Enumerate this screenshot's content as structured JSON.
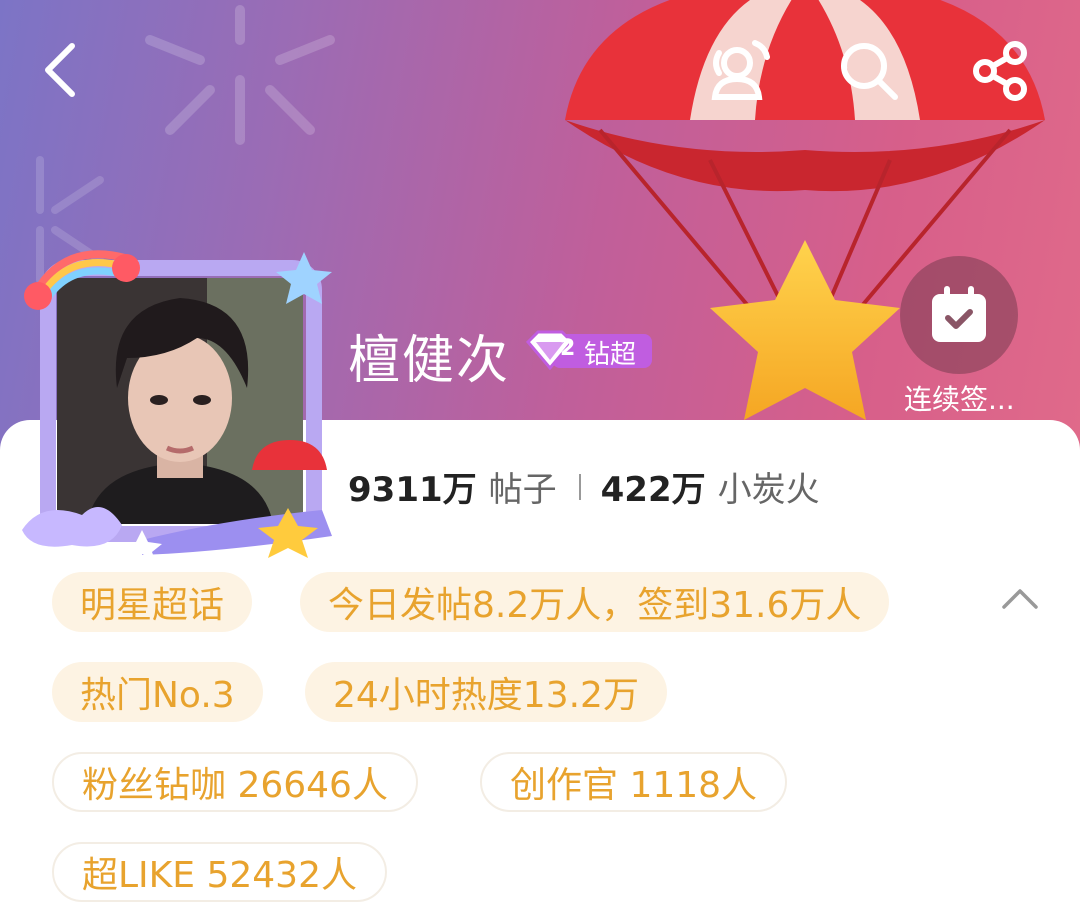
{
  "header": {
    "back_icon": "chevron-left-icon",
    "actions": [
      "friends-icon",
      "search-icon",
      "share-icon"
    ],
    "checkin_label": "连续签...",
    "colors": {
      "gradient_left": "#7c74c6",
      "gradient_right": "#e06a8a"
    }
  },
  "profile": {
    "name": "檀健次",
    "badge_level": "2",
    "badge_label": "钻超"
  },
  "stats": {
    "posts_value": "9311万",
    "posts_label": "帖子",
    "fire_value": "422万",
    "fire_label": "小炭火"
  },
  "tags": [
    {
      "label": "明星超话"
    },
    {
      "label": "今日发帖8.2万人，签到31.6万人"
    },
    {
      "label": "热门No.3"
    },
    {
      "label": "24小时热度13.2万"
    },
    {
      "label": "粉丝钻咖 26646人"
    },
    {
      "label": "创作官 1118人"
    },
    {
      "label": "超LIKE 52432人"
    }
  ],
  "accent": {
    "tag_text": "#e8a32e",
    "tag_bg": "#fdf3e3"
  }
}
